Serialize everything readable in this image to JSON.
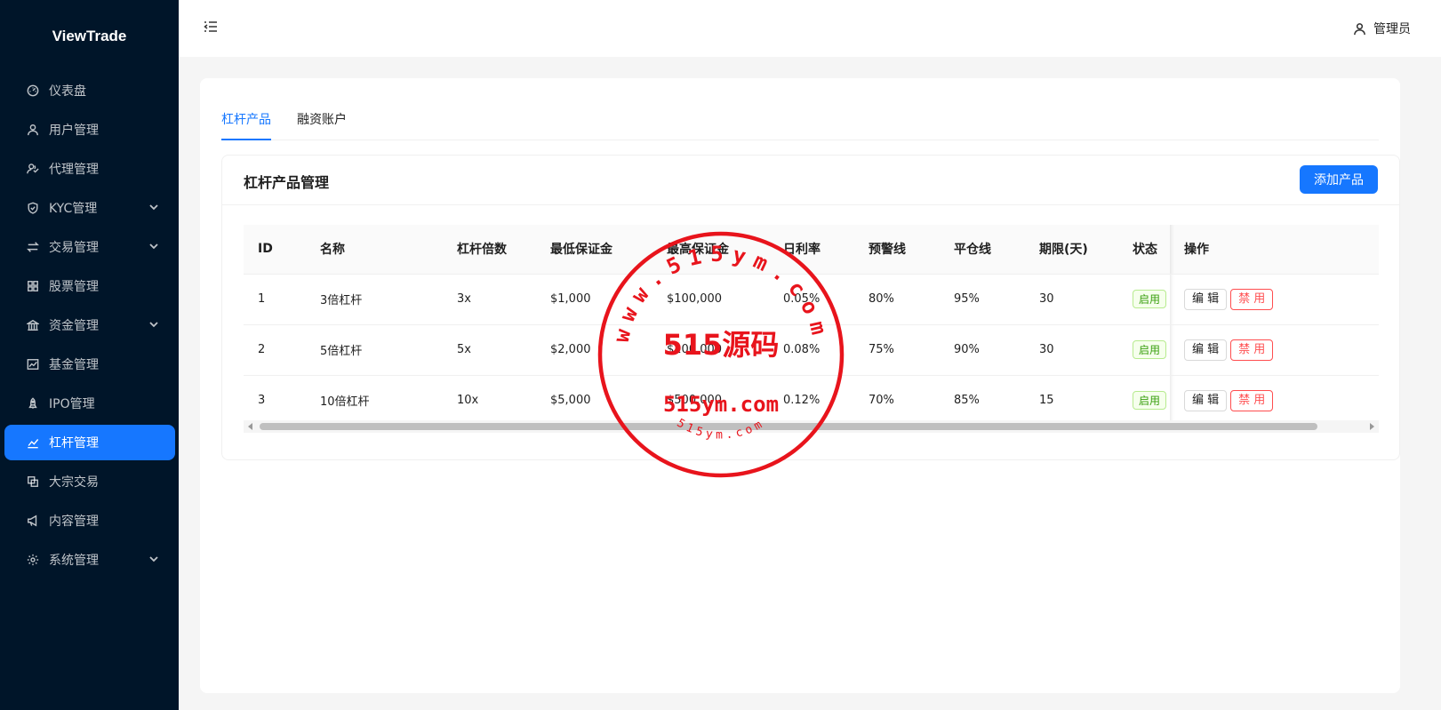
{
  "brand": "ViewTrade",
  "sidebar": {
    "items": [
      {
        "label": "仪表盘",
        "icon": "dashboard-icon"
      },
      {
        "label": "用户管理",
        "icon": "user-icon"
      },
      {
        "label": "代理管理",
        "icon": "agent-icon"
      },
      {
        "label": "KYC管理",
        "icon": "shield-icon",
        "expandable": true
      },
      {
        "label": "交易管理",
        "icon": "swap-icon",
        "expandable": true
      },
      {
        "label": "股票管理",
        "icon": "grid-icon"
      },
      {
        "label": "资金管理",
        "icon": "bank-icon",
        "expandable": true
      },
      {
        "label": "基金管理",
        "icon": "fund-chart-icon"
      },
      {
        "label": "IPO管理",
        "icon": "rocket-icon"
      },
      {
        "label": "杠杆管理",
        "icon": "line-chart-icon",
        "active": true
      },
      {
        "label": "大宗交易",
        "icon": "block-icon"
      },
      {
        "label": "内容管理",
        "icon": "megaphone-icon"
      },
      {
        "label": "系统管理",
        "icon": "gear-icon",
        "expandable": true
      }
    ]
  },
  "header": {
    "user_label": "管理员"
  },
  "tabs": [
    {
      "label": "杠杆产品",
      "active": true
    },
    {
      "label": "融资账户",
      "active": false
    }
  ],
  "panel": {
    "title": "杠杆产品管理",
    "add_label": "添加产品"
  },
  "table": {
    "columns": [
      "ID",
      "名称",
      "杠杆倍数",
      "最低保证金",
      "最高保证金",
      "日利率",
      "预警线",
      "平仓线",
      "期限(天)",
      "状态",
      "操作"
    ],
    "rows": [
      {
        "id": "1",
        "name": "3倍杠杆",
        "leverage": "3x",
        "min": "$1,000",
        "max": "$100,000",
        "rate": "0.05%",
        "warn": "80%",
        "liq": "95%",
        "days": "30",
        "status": "启用"
      },
      {
        "id": "2",
        "name": "5倍杠杆",
        "leverage": "5x",
        "min": "$2,000",
        "max": "$200,000",
        "rate": "0.08%",
        "warn": "75%",
        "liq": "90%",
        "days": "30",
        "status": "启用"
      },
      {
        "id": "3",
        "name": "10倍杠杆",
        "leverage": "10x",
        "min": "$5,000",
        "max": "$500,000",
        "rate": "0.12%",
        "warn": "70%",
        "liq": "85%",
        "days": "15",
        "status": "启用"
      }
    ],
    "edit_label": "编 辑",
    "ban_label": "禁 用"
  },
  "watermark": {
    "center": "515源码",
    "domain": "515ym.com",
    "ring_top": "www.515ym.com",
    "ring_bottom": "515ym.com"
  },
  "colors": {
    "sidebar_bg": "#001529",
    "accent": "#1677ff",
    "danger": "#ff4d4f",
    "success": "#389e0d",
    "stamp": "#e8141c"
  }
}
